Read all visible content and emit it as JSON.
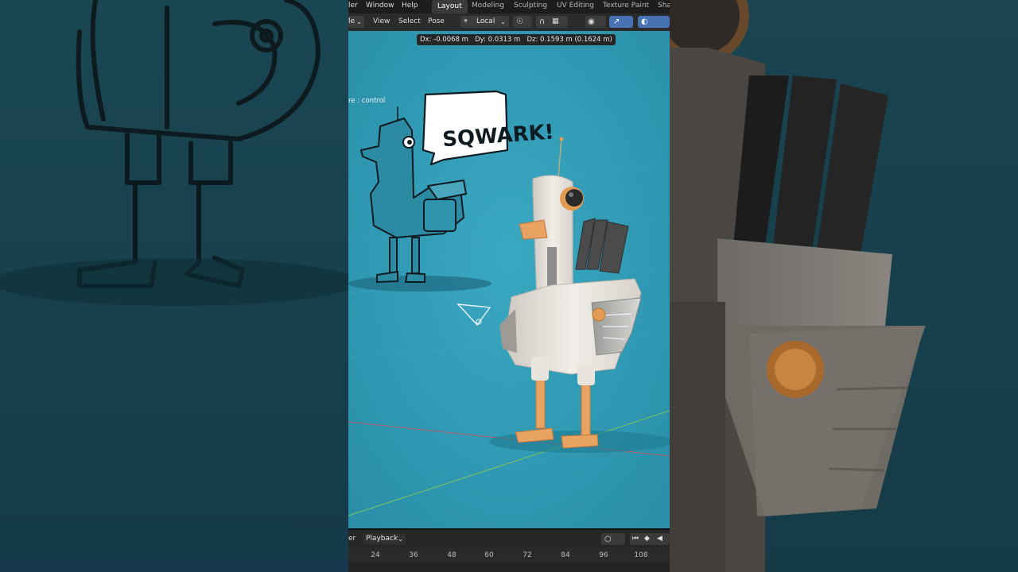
{
  "menu": {
    "items": [
      "ler",
      "Window",
      "Help"
    ],
    "workspaces": [
      "Layout",
      "Modeling",
      "Sculpting",
      "UV Editing",
      "Texture Paint",
      "Sha"
    ],
    "active_workspace": "Layout"
  },
  "viewport_header": {
    "mode_fragment": "le",
    "menus": [
      "View",
      "Select",
      "Pose"
    ],
    "transform_orientation": "Local"
  },
  "transform_readout": {
    "dx_label": "Dx:",
    "dx": "-0.0068 m",
    "dy_label": "Dy:",
    "dy": "0.0313 m",
    "dz_label": "Dz:",
    "dz": "0.1593 m (0.1624 m)"
  },
  "active_object": "re : control",
  "sketch": {
    "speech": "SQWARK!"
  },
  "timeline": {
    "left_fragment": "er",
    "playback_label": "Playback",
    "frames": [
      "24",
      "36",
      "48",
      "60",
      "72",
      "84",
      "96",
      "108"
    ]
  },
  "colors": {
    "viewport_bg": "#2f9bb5",
    "ui_dark": "#1d1d1d",
    "header": "#2b2b2b",
    "accent_orange": "#e39a55"
  }
}
